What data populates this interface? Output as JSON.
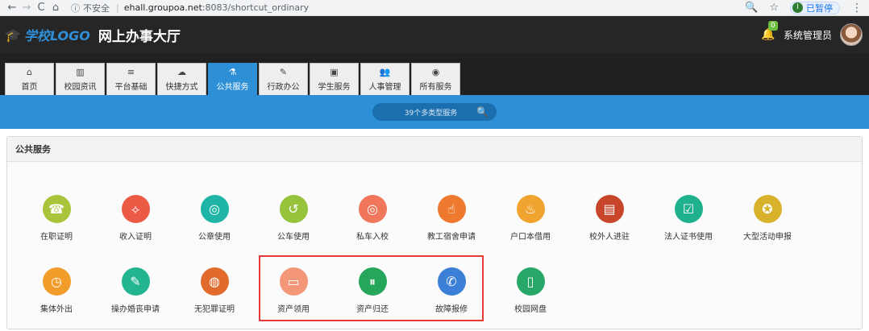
{
  "browser": {
    "back": "←",
    "forward": "→",
    "reload": "C",
    "home": "⌂",
    "info_icon": "ⓘ",
    "insecure_label": "不安全",
    "separator": "|",
    "host": "ehall.groupoa.net",
    "path": ":8083/shortcut_ordinary",
    "zoom_icon": "🔍",
    "star_icon": "☆",
    "profile_initial": "I",
    "profile_status": "已暂停",
    "menu_icon": "⋮"
  },
  "header": {
    "cap_icon": "🎓",
    "logo_text": "学校LOGO",
    "title": "网上办事大厅",
    "bell_icon": "🔔",
    "notification_count": "0",
    "user_label": "系统管理员"
  },
  "tabs": [
    {
      "icon": "⌂",
      "label": "首页"
    },
    {
      "icon": "▥",
      "label": "校园资讯"
    },
    {
      "icon": "≡",
      "label": "平台基础"
    },
    {
      "icon": "☁",
      "label": "快捷方式"
    },
    {
      "icon": "⚗",
      "label": "公共服务",
      "active": true
    },
    {
      "icon": "✎",
      "label": "行政办公"
    },
    {
      "icon": "▣",
      "label": "学生服务"
    },
    {
      "icon": "👥",
      "label": "人事管理"
    },
    {
      "icon": "◉",
      "label": "所有服务"
    }
  ],
  "search": {
    "label": "39个多类型服务",
    "icon": "🔍"
  },
  "panel": {
    "title": "公共服务"
  },
  "services": [
    {
      "label": "在职证明",
      "icon": "☎",
      "color": "#a9c43a"
    },
    {
      "label": "收入证明",
      "icon": "⟡",
      "color": "#ec5a45"
    },
    {
      "label": "公章使用",
      "icon": "◎",
      "color": "#1fb5a6"
    },
    {
      "label": "公车使用",
      "icon": "↺",
      "color": "#96c23c"
    },
    {
      "label": "私车入校",
      "icon": "◎",
      "color": "#f0765c"
    },
    {
      "label": "教工宿舍申请",
      "icon": "☝",
      "color": "#ee7a2f"
    },
    {
      "label": "户口本借用",
      "icon": "♨",
      "color": "#f0a32e"
    },
    {
      "label": "校外人进驻",
      "icon": "▤",
      "color": "#c7462a"
    },
    {
      "label": "法人证书使用",
      "icon": "☑",
      "color": "#1fb08e"
    },
    {
      "label": "大型活动申报",
      "icon": "✪",
      "color": "#d9b22c"
    },
    {
      "label": "集体外出",
      "icon": "◷",
      "color": "#f29c2b"
    },
    {
      "label": "操办婚丧申请",
      "icon": "✎",
      "color": "#22b58f"
    },
    {
      "label": "无犯罪证明",
      "icon": "◍",
      "color": "#e26a2c"
    },
    {
      "label": "资产领用",
      "icon": "▭",
      "color": "#f39778"
    },
    {
      "label": "资产归还",
      "icon": "⏸",
      "color": "#25a65a"
    },
    {
      "label": "故障报修",
      "icon": "✆",
      "color": "#3c7fd6"
    },
    {
      "label": "校园网盘",
      "icon": "▯",
      "color": "#27a868"
    }
  ]
}
